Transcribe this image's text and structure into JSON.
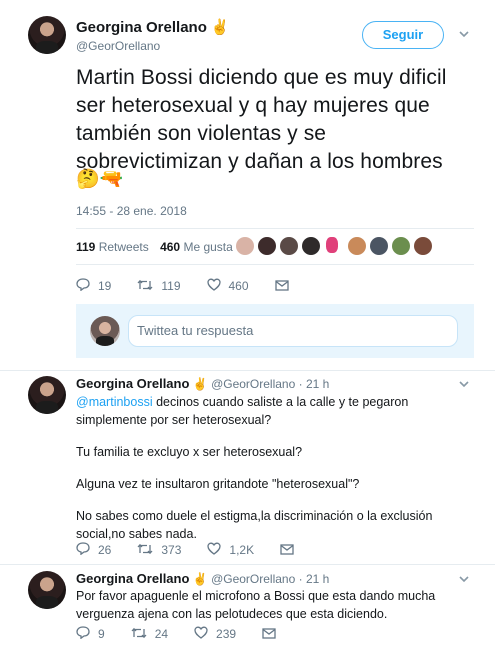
{
  "main": {
    "name": "Georgina Orellano",
    "name_emoji": "✌️",
    "handle": "@GeorOrellano",
    "follow_label": "Seguir",
    "text": "Martin Bossi diciendo que es muy dificil ser heterosexual y q hay mujeres que también son violentas y se sobrevictimizan y dañan a los hombres",
    "emojis": "🤔🔫",
    "time": "14:55 - 28 ene. 2018",
    "retweets_count": "119",
    "retweets_label": "Retweets",
    "likes_count": "460",
    "likes_label": "Me gusta",
    "actions": {
      "replies": "19",
      "retweets": "119",
      "likes": "460"
    }
  },
  "reply_box": {
    "placeholder": "Twittea tu respuesta"
  },
  "replies": [
    {
      "name": "Georgina Orellano",
      "emoji": "✌️",
      "handle": "@GeorOrellano",
      "time": "· 21 h",
      "mention": "@martinbossi",
      "line1": " decinos cuando saliste a la calle y te pegaron simplemente por ser heterosexual?",
      "p2": "Tu familia te excluyo x ser heterosexual?",
      "p3": "Alguna vez te insultaron gritandote \"heterosexual\"?",
      "p4": "No sabes como duele el estigma,la discriminación o la exclusión social,no sabes nada.",
      "actions": {
        "replies": "26",
        "retweets": "373",
        "likes": "1,2K"
      }
    },
    {
      "name": "Georgina Orellano",
      "emoji": "✌️",
      "handle": "@GeorOrellano",
      "time": "· 21 h",
      "text": "Por favor apaguenle el microfono a Bossi que esta dando mucha verguenza ajena con las pelotudeces que esta diciendo.",
      "actions": {
        "replies": "9",
        "retweets": "24",
        "likes": "239"
      }
    }
  ],
  "icons": {
    "reply": "reply-icon",
    "retweet": "retweet-icon",
    "like": "heart-icon",
    "dm": "envelope-icon",
    "caret": "chevron-down-icon"
  },
  "colors": {
    "accent": "#1da1f2",
    "secondary_text": "#657786",
    "reply_bg": "#e8f5fd"
  }
}
